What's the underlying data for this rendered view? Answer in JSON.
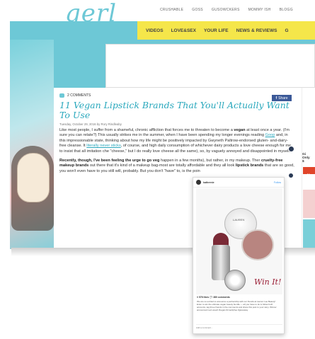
{
  "site": {
    "logo": "gerl",
    "partner_sites": [
      "CRUSHABLE",
      "GOSS",
      "GUSOWCKERS",
      "Mommy Ish",
      "BLOGG"
    ],
    "nav": [
      "VIDEOS",
      "LOVE&SEX",
      "YOUR LIFE",
      "NEWS & REVIEWS",
      "G"
    ]
  },
  "article": {
    "comments": "2 COMMENTS",
    "share": "Share",
    "title": "11 Vegan Lipstick Brands That You'll Actually Want To Use",
    "byline": "Tuesday, October 29, 2016 by Rory Rindleaby",
    "p1_a": "Like most people, I suffer from a shameful, chronic affliction that forces me to threaten to become a ",
    "p1_b": "vegan",
    "p1_c": " at least once a year. (I'm sure you can relate?) This usually strikes me in the summer, when I have been spending my longer evenings reading ",
    "p1_link1": "Goop",
    "p1_d": " and, in this impressionable state, thinking about how my life might be positively impacted by Gwyneth Paltrow-endorsed gluten- and-dairy-free cleanse. It ",
    "p1_link2": "literally never sticks",
    "p1_e": ", of course, and high daily consumption of whichever dairy products a love cheese enough for me to insist that all imitation che \"cheese,\" but I do really love cheese all the same), so, by vaguely annoyed and disappointed in myself.",
    "p2_bold": "Recently, though, I've been feeling the urge to go veg",
    "p2_a": " happen in a few months), but rather, in my makeup. Ther ",
    "p2_bold2": "cruelty-free makeup brands",
    "p2_b": " out there that it's kind of a makeup bag-most are totally affordable and they all look ",
    "p2_bold3": "lipstick brands",
    "p2_c": " that are so good, you won't even have to you still will, probably. But you don't \"have\" to, is the poin"
  },
  "sidebar": {
    "label_lines": [
      "Gi",
      "Only"
    ],
    "price": "$",
    "cta": "V"
  },
  "instagram": {
    "username": "kathrenie",
    "follow": "Follow",
    "brand_on_compact": "LAUREN",
    "win_text": "Win It!",
    "likes": "♥ 576 likes   💬 380 comments",
    "caption": "We are so excited to announce a partnership with our friends at Lauren Lee Beauty! Enter to win the ultimate vegan beauty bundle — all you have to do is follow both accounts, tag three friends in the comments and share this post to your story. Winner announced next week! #vegan #crueltyfree #giveaway",
    "footer": "Add a comment..."
  }
}
